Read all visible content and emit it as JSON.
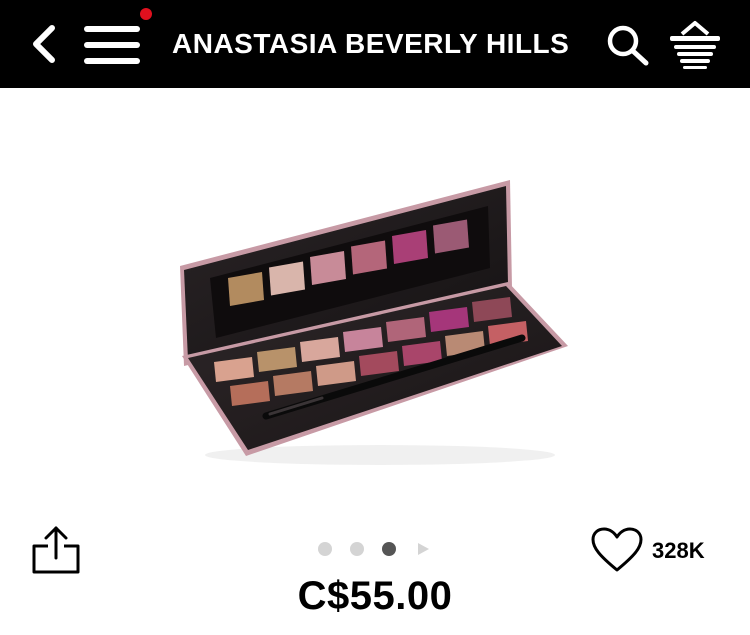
{
  "header": {
    "title": "ANASTASIA BEVERLY HILLS",
    "back_icon": "chevron-left-icon",
    "menu_icon": "hamburger-menu-icon",
    "search_icon": "search-icon",
    "basket_icon": "basket-icon",
    "notification_color": "#e0101e",
    "background": "#000000"
  },
  "product": {
    "image_description_icon": "eyeshadow-palette-image",
    "price": "C$55.00",
    "likes": "328K",
    "swatches": {
      "lid": [
        "#b28b5f",
        "#d9b5ab",
        "#c88b98",
        "#b4667a",
        "#a93f76",
        "#9b5a74"
      ],
      "top_row": [
        "#d9a28f",
        "#b8926a",
        "#d8a79c",
        "#c7849b",
        "#b06579",
        "#a5367a",
        "#8e4857"
      ],
      "bottom_row": [
        "#b56e5a",
        "#b57a63",
        "#cf9a88",
        "#a34a5d",
        "#a9456a",
        "#b98a74",
        "#c56064"
      ]
    }
  },
  "carousel": {
    "inactive_color": "#d4d4d4",
    "active_color": "#555555",
    "active_index": 3,
    "video_icon": "play-triangle-icon"
  },
  "actions": {
    "share_icon": "share-icon",
    "like_icon": "heart-icon"
  }
}
